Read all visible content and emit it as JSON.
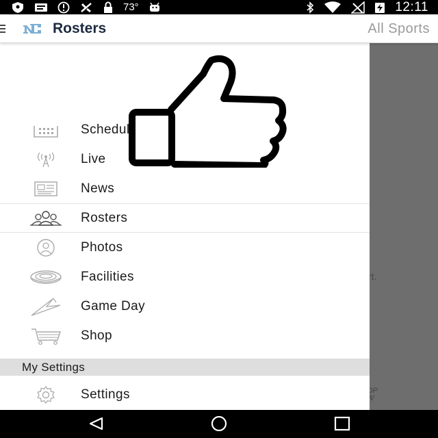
{
  "status_bar": {
    "temperature": "73°",
    "time": "12:11",
    "icons": [
      "shield-icon",
      "message-icon",
      "alert-icon",
      "no-notify-icon",
      "lock-icon",
      "android-icon",
      "bluetooth-icon",
      "wifi-icon",
      "no-signal-icon",
      "battery-charging-icon"
    ]
  },
  "app_bar": {
    "title": "Rosters",
    "filter_label": "All Sports",
    "logo": "nc-logo-icon",
    "accent_color": "#7bafd4"
  },
  "drawer": {
    "items": [
      {
        "label": "Schedules",
        "icon": "calendar-icon"
      },
      {
        "label": "Live",
        "icon": "broadcast-icon"
      },
      {
        "label": "News",
        "icon": "newspaper-icon"
      },
      {
        "label": "Rosters",
        "icon": "people-icon",
        "active": true
      },
      {
        "label": "Photos",
        "icon": "photo-person-icon"
      },
      {
        "label": "Facilities",
        "icon": "stadium-icon"
      },
      {
        "label": "Game Day",
        "icon": "pennant-icon"
      },
      {
        "label": "Shop",
        "icon": "cart-icon"
      }
    ],
    "section_header": "My Settings",
    "settings_item": {
      "label": "Settings",
      "icon": "gear-icon"
    }
  },
  "background": {
    "partial_text": "rt.",
    "partial_footer_line1": "OP",
    "partial_footer_line2": "W"
  },
  "overlay": {
    "icon": "thumbs-up-icon"
  },
  "nav_bar": {
    "icons": [
      "back-icon",
      "home-icon",
      "recents-icon"
    ]
  }
}
